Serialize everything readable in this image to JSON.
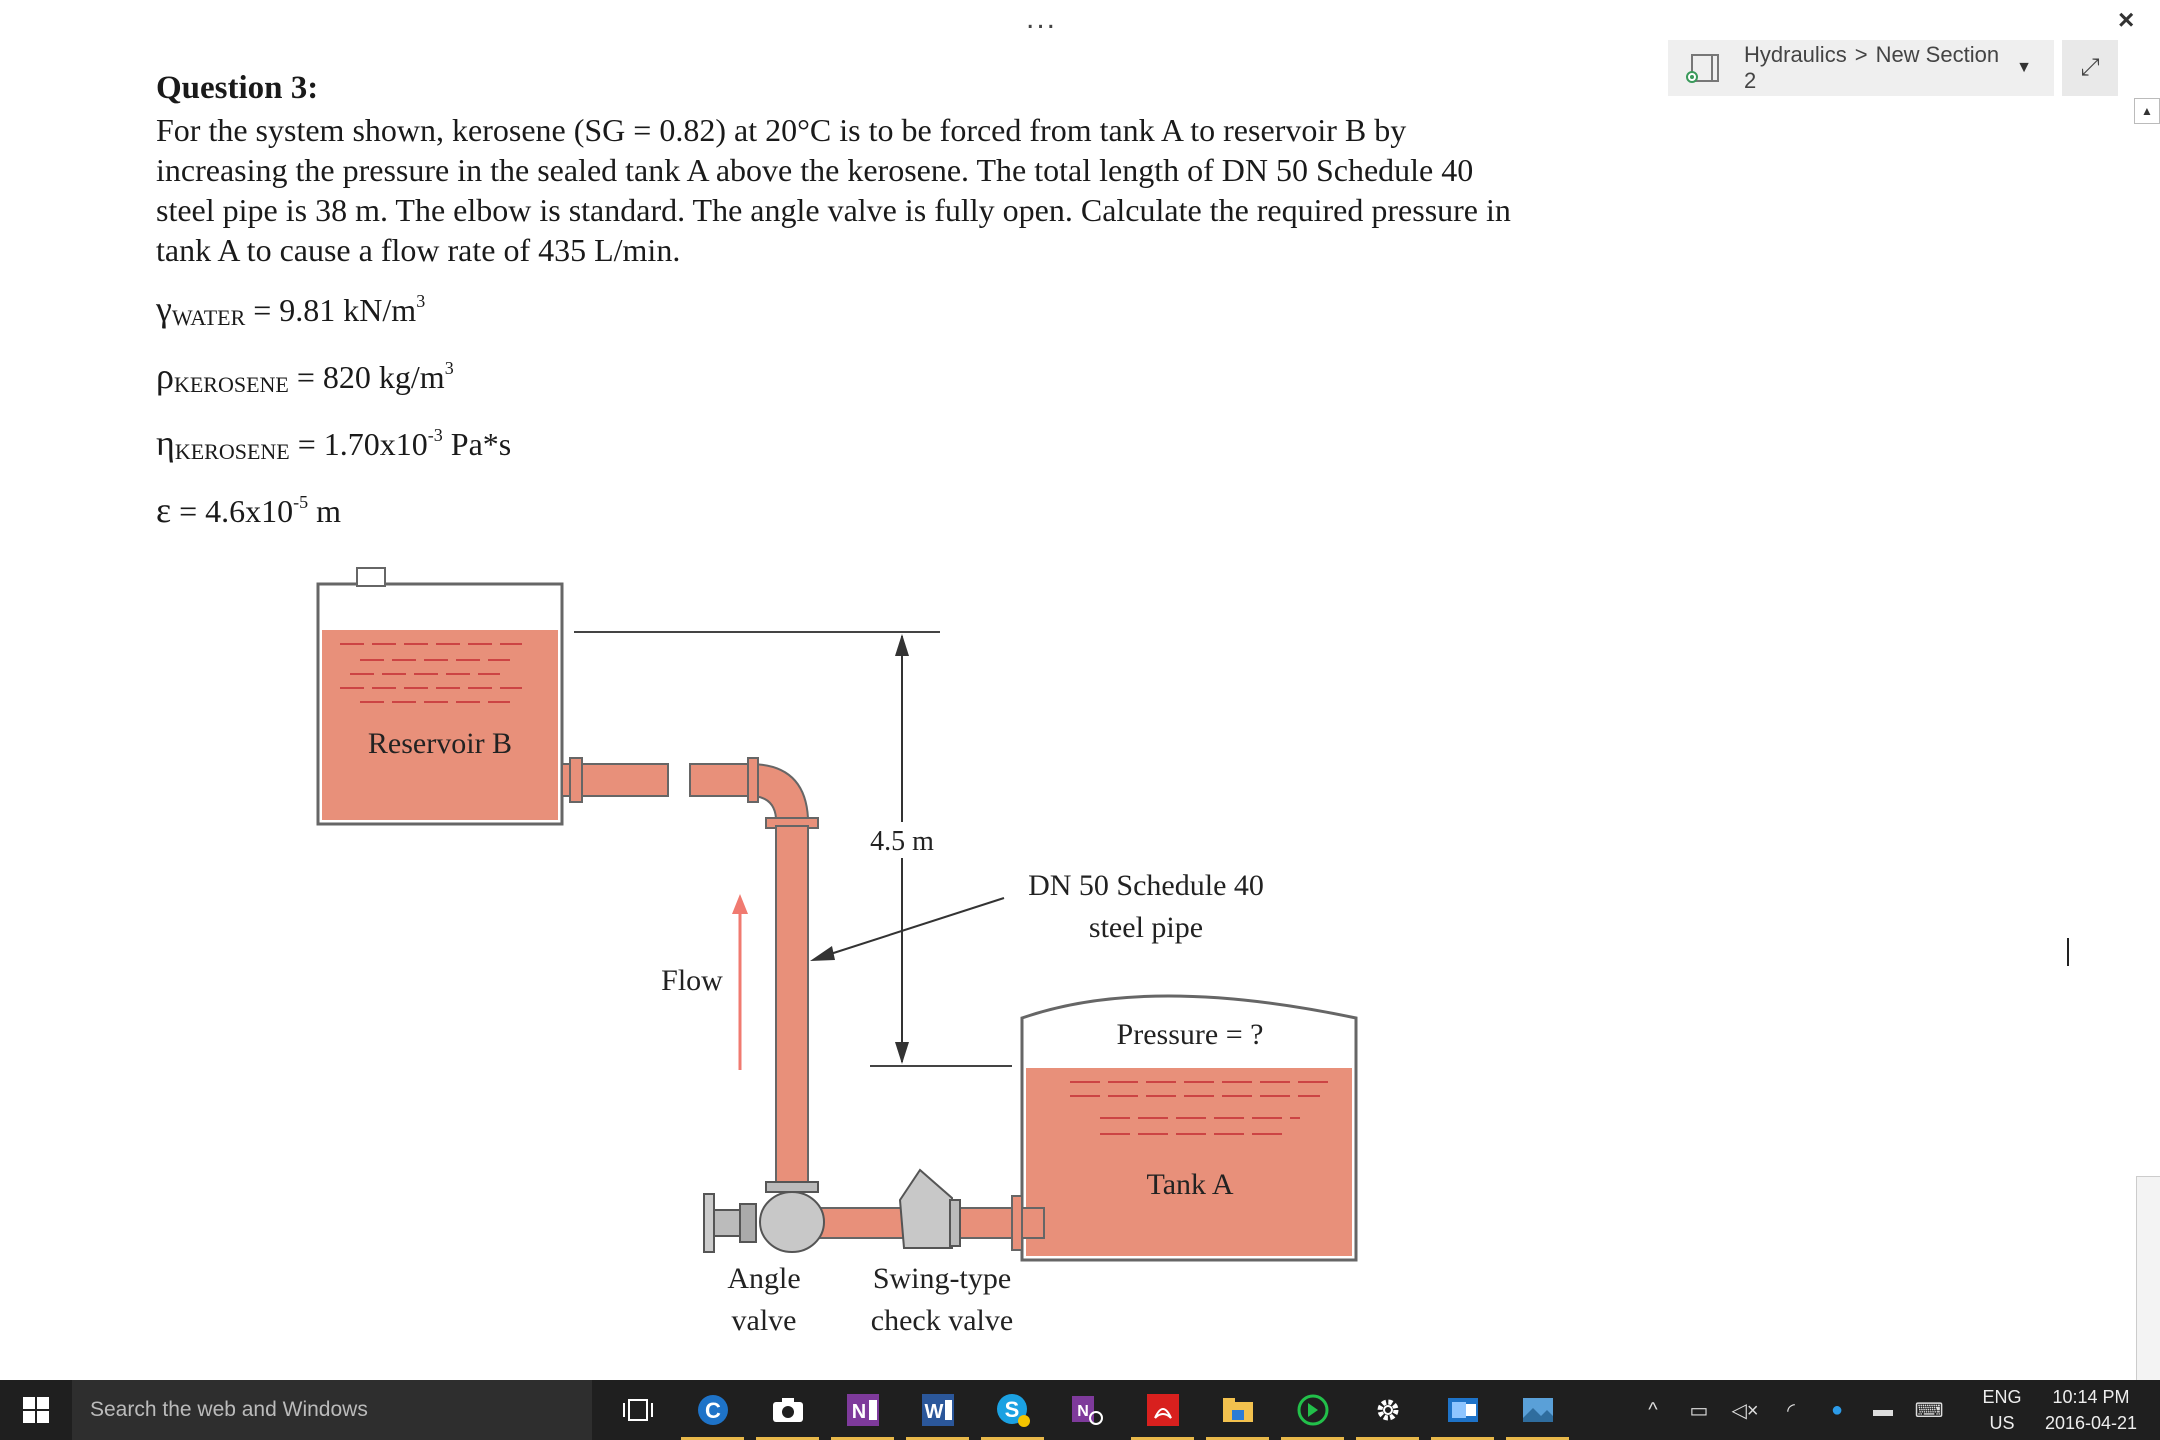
{
  "window": {
    "more_label": "...",
    "close_label": "×",
    "breadcrumb": {
      "notebook": "Hydraulics",
      "separator": ">",
      "section": "New Section 2"
    },
    "expand_label": "⤢",
    "scroll_up_label": "▲"
  },
  "question": {
    "title": "Question 3:",
    "body": "For the system shown, kerosene (SG = 0.82) at 20°C is to be forced from tank A to reservoir B by increasing the pressure in the sealed tank A above the kerosene. The total length of DN 50 Schedule 40 steel pipe is 38 m. The elbow is standard. The angle valve is fully open. Calculate the required pressure in tank A to cause a flow rate of 435 L/min.",
    "equations": [
      {
        "symbol": "γ",
        "sub": "WATER",
        "rhs": " = 9.81 kN/m",
        "sup": "3",
        "tail": ""
      },
      {
        "symbol": "ρ",
        "sub": "KEROSENE",
        "rhs": " = 820 kg/m",
        "sup": "3",
        "tail": ""
      },
      {
        "symbol": "η",
        "sub": "KEROSENE",
        "rhs": " = 1.70x10",
        "sup": "-3",
        "tail": " Pa*s"
      },
      {
        "symbol": "ε",
        "sub": "",
        "rhs": " = 4.6x10",
        "sup": "-5",
        "tail": " m"
      }
    ]
  },
  "diagram": {
    "reservoir_label": "Reservoir B",
    "tank_label": "Tank A",
    "pressure_label": "Pressure = ?",
    "height_label": "4.5 m",
    "pipe_label_1": "DN 50 Schedule 40",
    "pipe_label_2": "steel pipe",
    "flow_label": "Flow",
    "angle_valve_1": "Angle",
    "angle_valve_2": "valve",
    "check_valve_1": "Swing-type",
    "check_valve_2": "check valve",
    "colors": {
      "fluid": "#e8907a",
      "pipe": "#e8907a",
      "outline": "#555555",
      "arrow_flow": "#f07a70"
    }
  },
  "taskbar": {
    "search_placeholder": "Search the web and Windows",
    "apps": [
      "task-view",
      "cortana-c",
      "camera",
      "onenote",
      "word",
      "skype",
      "onenote-tools",
      "acrobat",
      "file-explorer",
      "green-app",
      "settings",
      "outlook",
      "photos"
    ],
    "lang_1": "ENG",
    "lang_2": "US",
    "time": "10:14 PM",
    "date": "2016-04-21"
  }
}
